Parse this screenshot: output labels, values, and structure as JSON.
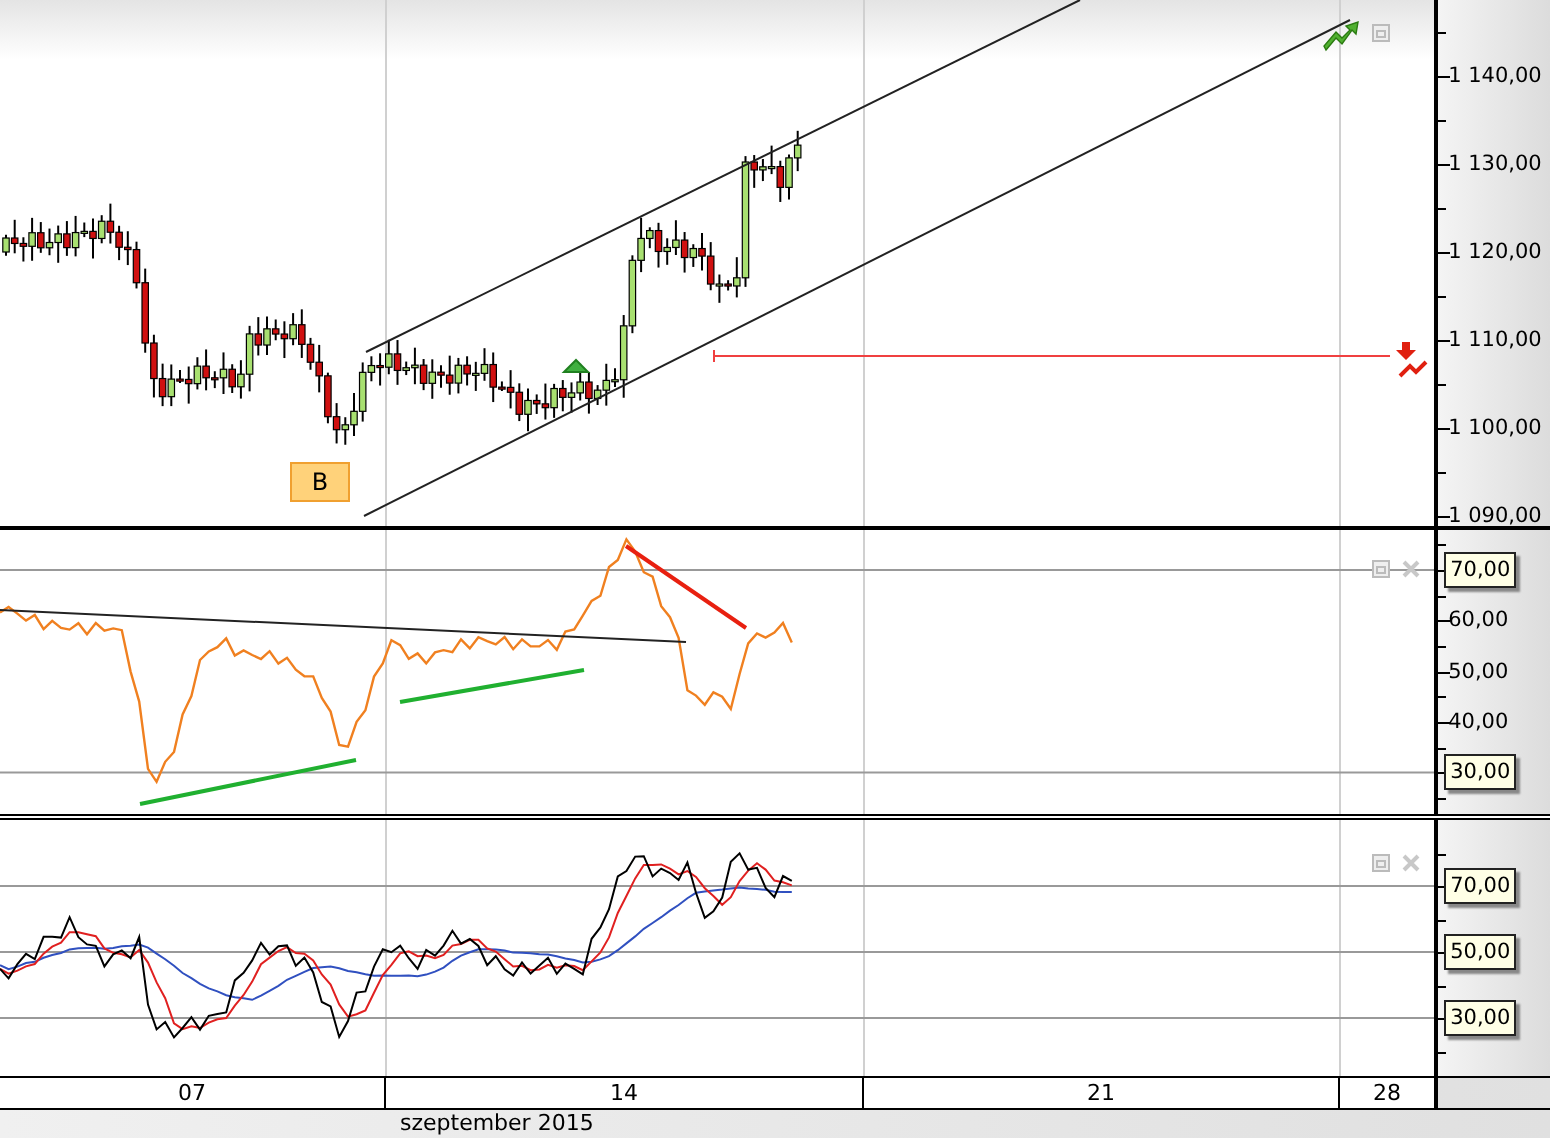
{
  "price_panel": {
    "y_labels": [
      {
        "text": "1 140,00",
        "boxed": false
      },
      {
        "text": "1 130,00",
        "boxed": false
      },
      {
        "text": "1 120,00",
        "boxed": false
      },
      {
        "text": "1 110,00",
        "boxed": false
      },
      {
        "text": "1 100,00",
        "boxed": false
      },
      {
        "text": "1 090,00",
        "boxed": false
      }
    ],
    "signal_marker": {
      "label": "B"
    }
  },
  "rsi_panel": {
    "y_labels": [
      {
        "text": "70,00",
        "boxed": true
      },
      {
        "text": "60,00",
        "boxed": false
      },
      {
        "text": "50,00",
        "boxed": false
      },
      {
        "text": "40,00",
        "boxed": false
      },
      {
        "text": "30,00",
        "boxed": true
      }
    ]
  },
  "stoch_panel": {
    "y_labels": [
      {
        "text": "70,00",
        "boxed": true
      },
      {
        "text": "50,00",
        "boxed": true
      },
      {
        "text": "30,00",
        "boxed": true
      }
    ]
  },
  "x_axis": {
    "labels": [
      "07",
      "14",
      "21",
      "28"
    ],
    "caption": "szeptember 2015"
  }
}
